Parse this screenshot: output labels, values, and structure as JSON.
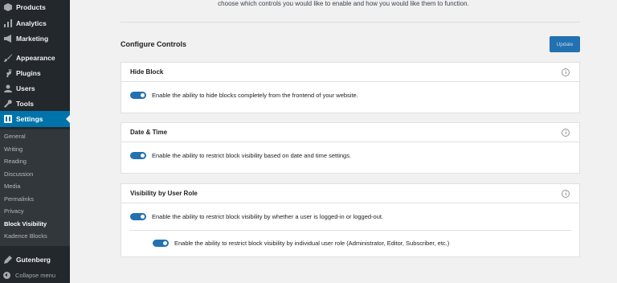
{
  "sidebar": {
    "items": [
      {
        "label": "Products",
        "icon": "products-icon"
      },
      {
        "label": "Analytics",
        "icon": "analytics-icon"
      },
      {
        "label": "Marketing",
        "icon": "megaphone-icon"
      },
      {
        "label": "Appearance",
        "icon": "paintbrush-icon"
      },
      {
        "label": "Plugins",
        "icon": "plugin-icon"
      },
      {
        "label": "Users",
        "icon": "users-icon"
      },
      {
        "label": "Tools",
        "icon": "wrench-icon"
      },
      {
        "label": "Settings",
        "icon": "settings-icon",
        "active": true
      }
    ],
    "settings_submenu": [
      {
        "label": "General"
      },
      {
        "label": "Writing"
      },
      {
        "label": "Reading"
      },
      {
        "label": "Discussion"
      },
      {
        "label": "Media"
      },
      {
        "label": "Permalinks"
      },
      {
        "label": "Privacy"
      },
      {
        "label": "Block Visibility",
        "current": true
      },
      {
        "label": "Kadence Blocks"
      }
    ],
    "gutenberg": {
      "label": "Gutenberg",
      "icon": "gutenberg-icon"
    },
    "collapse_label": "Collapse menu"
  },
  "main": {
    "intro_text": "choose which controls you would like to enable and how you would like them to function.",
    "configure_title": "Configure Controls",
    "update_label": "Update",
    "panels": [
      {
        "title": "Hide Block",
        "toggles": [
          {
            "label": "Enable the ability to hide blocks completely from the frontend of your website.",
            "on": true
          }
        ]
      },
      {
        "title": "Date & Time",
        "toggles": [
          {
            "label": "Enable the ability to restrict block visibility based on date and time settings.",
            "on": true
          }
        ]
      },
      {
        "title": "Visibility by User Role",
        "toggles": [
          {
            "label": "Enable the ability to restrict block visibility by whether a user is logged-in or logged-out.",
            "on": true
          },
          {
            "label": "Enable the ability to restrict block visibility by individual user role (Administrator, Editor, Subscriber, etc.)",
            "on": true
          }
        ]
      }
    ]
  },
  "colors": {
    "sidebar_bg": "#23282d",
    "submenu_bg": "#32373c",
    "accent": "#0073aa",
    "toggle_on": "#2271b1",
    "page_bg": "#f1f1f1"
  }
}
